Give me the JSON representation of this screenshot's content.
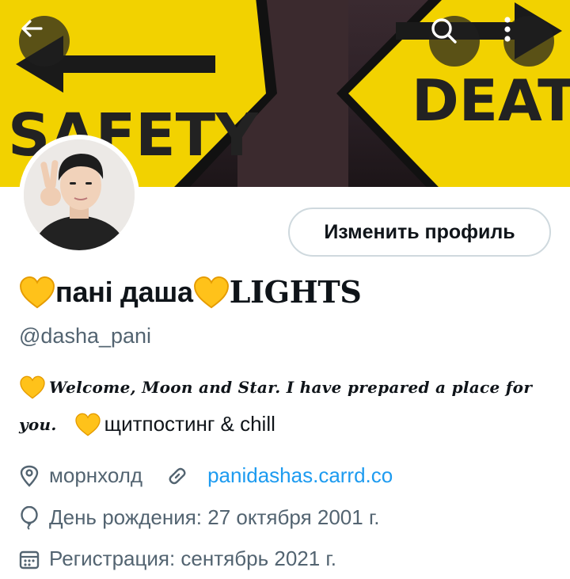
{
  "banner": {
    "left_sign_text": "SAFETY",
    "right_sign_text": "DEATH",
    "sign_color": "#f2d200"
  },
  "header_buttons": {
    "back_icon": "arrow-left-icon",
    "search_icon": "search-icon",
    "more_icon": "more-vertical-icon"
  },
  "profile": {
    "edit_button_label": "Изменить профиль",
    "name_part1": "пані даша",
    "name_part2": "LIGHTS",
    "handle": "@dasha_pani",
    "bio_line1": "Welcome, Moon and Star. I have prepared a place for",
    "bio_line2_script": "you.",
    "bio_line2_plain": "щитпостинг & chill",
    "heart_color": "#ffc21a"
  },
  "meta": {
    "location": "морнхолд",
    "website": "panidashas.carrd.co",
    "birthday": "День рождения: 27 октября 2001 г.",
    "joined": "Регистрация: сентябрь 2021 г.",
    "link_color": "#1d9bf0"
  }
}
